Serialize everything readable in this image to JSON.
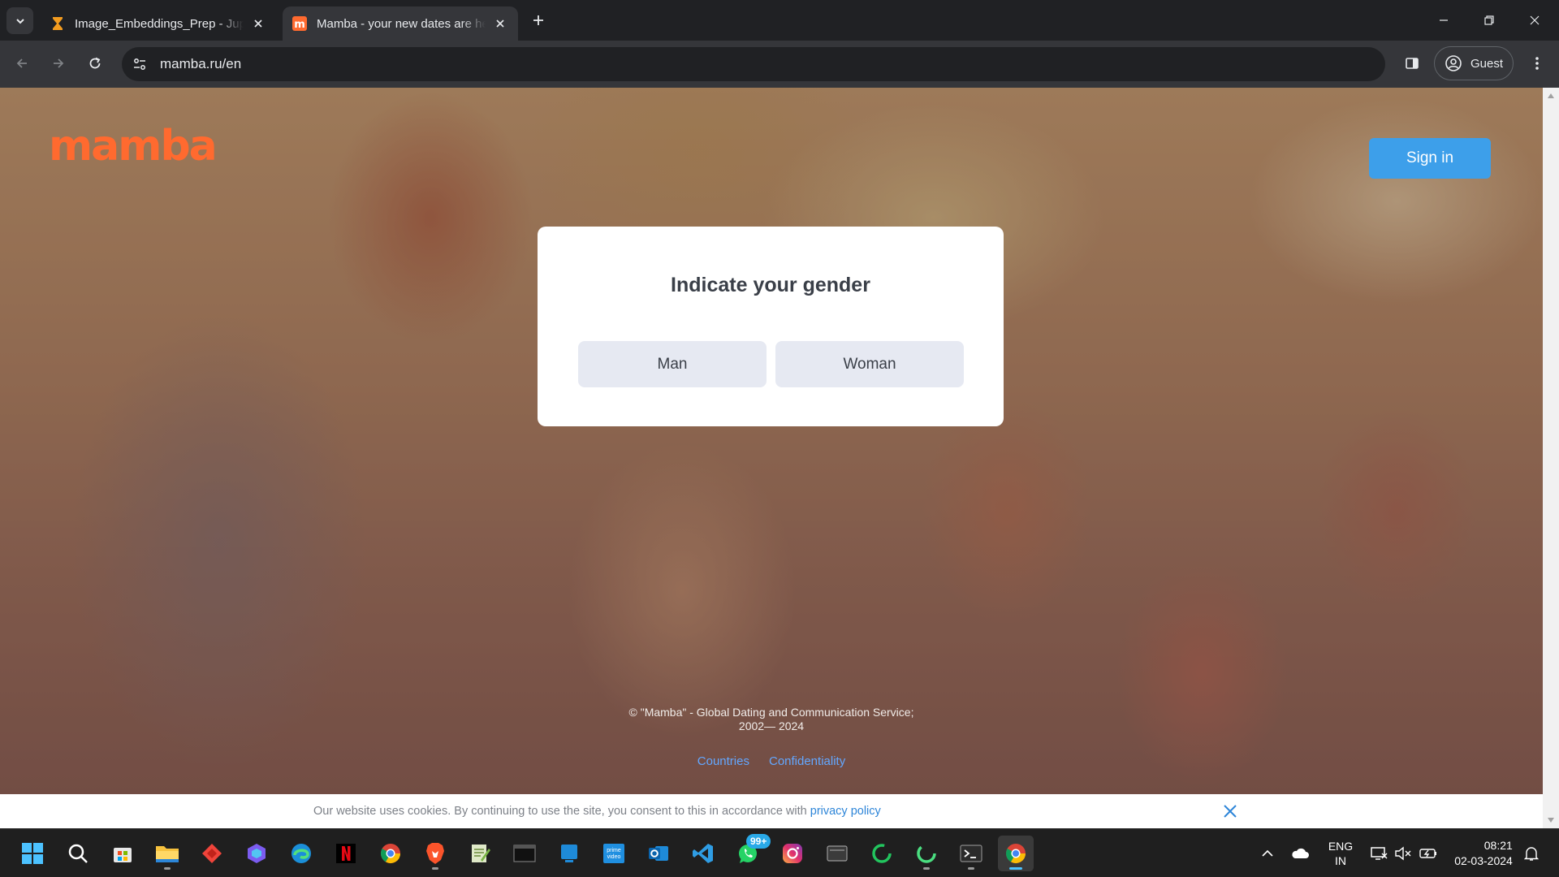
{
  "browser": {
    "tabs": [
      {
        "title": "Image_Embeddings_Prep - Jupyter",
        "favicon": "hourglass-icon",
        "active": false
      },
      {
        "title": "Mamba - your new dates are here",
        "favicon": "mamba-favicon",
        "active": true
      }
    ],
    "url": "mamba.ru/en",
    "profile_label": "Guest"
  },
  "page": {
    "logo_text": "mamba",
    "sign_in_label": "Sign in",
    "modal": {
      "title": "Indicate your gender",
      "options": [
        "Man",
        "Woman"
      ]
    },
    "footer": {
      "copyright_line1": "© \"Mamba\" - Global Dating and Communication Service;",
      "copyright_line2": "2002— 2024",
      "links": [
        "Countries",
        "Confidentiality"
      ]
    },
    "cookie_bar": {
      "text": "Our website uses cookies. By continuing to use the site, you consent to this in accordance with ",
      "link_text": "privacy policy"
    }
  },
  "colors": {
    "brand": "#ff6a2f",
    "sign_in": "#3d9fea",
    "link": "#63a7ff",
    "cookie_link": "#2d85d8"
  },
  "taskbar": {
    "apps": [
      "windows-start-icon",
      "search-icon",
      "microsoft-store-icon",
      "file-explorer-icon",
      "anydesk-icon",
      "copilot-icon",
      "edge-icon",
      "netflix-icon",
      "chrome-icon",
      "brave-icon",
      "notepad-plus-icon",
      "terminal-icon",
      "windows-app-icon",
      "prime-video-icon",
      "outlook-icon",
      "vscode-icon",
      "whatsapp-icon",
      "instagram-icon",
      "folder-app-icon",
      "loader-app-icon",
      "loader-app-icon-2",
      "terminal-app-icon",
      "chrome-active-icon"
    ],
    "whatsapp_badge": "99+",
    "language_line1": "ENG",
    "language_line2": "IN",
    "time": "08:21",
    "date": "02-03-2024"
  }
}
